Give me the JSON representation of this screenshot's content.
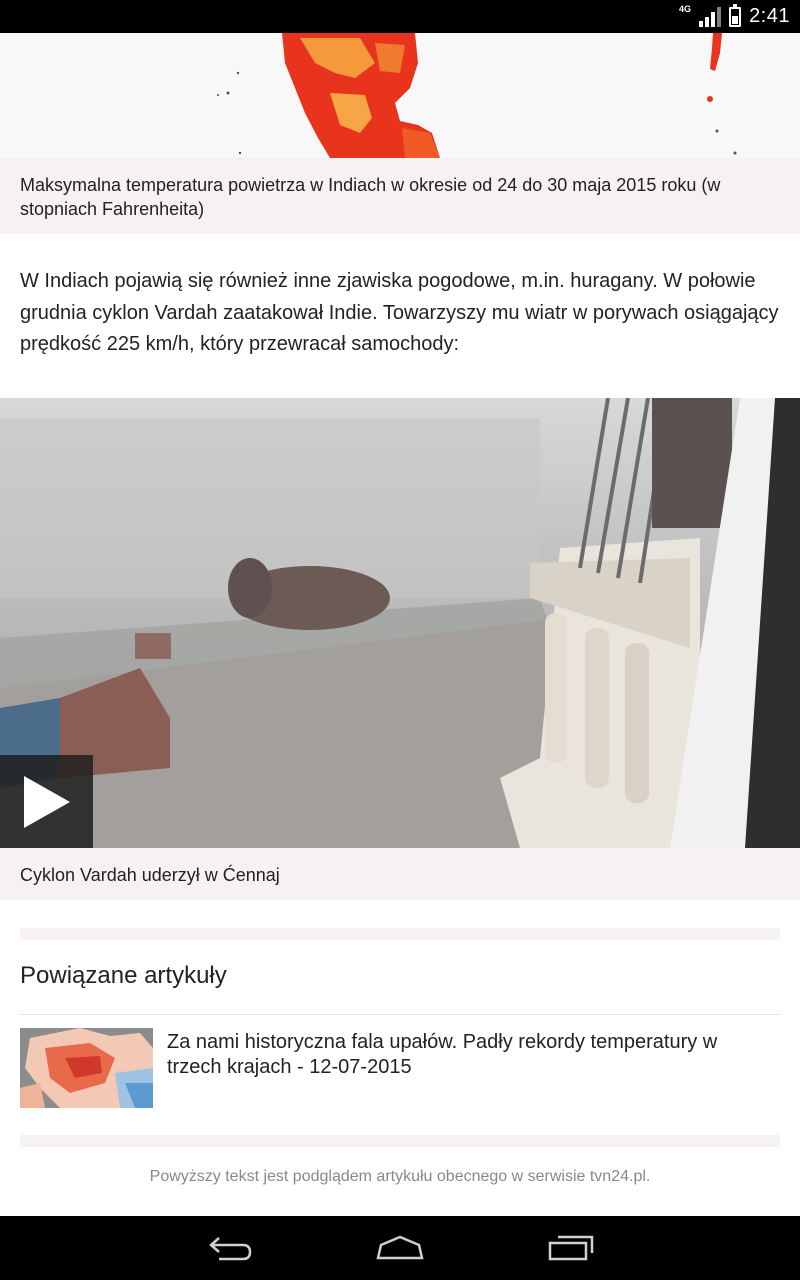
{
  "status_bar": {
    "network": "4G",
    "time": "2:41"
  },
  "captions": {
    "map": "Maksymalna temperatura powietrza w Indiach w okresie od 24 do 30 maja 2015 roku (w stopniach Fahrenheita)",
    "video": "Cyklon Vardah uderzył w Ćennaj"
  },
  "article": {
    "paragraph": "W Indiach pojawią się również inne zjawiska pogodowe, m.in. huragany. W połowie grudnia cyklon Vardah zaatakował Indie. Towarzyszy mu wiatr w porywach osiągający prędkość 225 km/h, który przewracał samochody:"
  },
  "related": {
    "heading": "Powiązane artykuły",
    "items": [
      {
        "title": "Za nami historyczna fala upałów. Padły rekordy temperatury w trzech krajach - 12-07-2015"
      }
    ]
  },
  "footer": {
    "note": "Powyższy tekst jest podglądem artykułu obecnego w serwisie tvn24.pl."
  },
  "navigation": {
    "back": "back-icon",
    "home": "home-icon",
    "recents": "recents-icon"
  },
  "colors": {
    "caption_bg": "#f5f1f4",
    "map_red": "#e8341c",
    "map_orange": "#f59a3c"
  }
}
